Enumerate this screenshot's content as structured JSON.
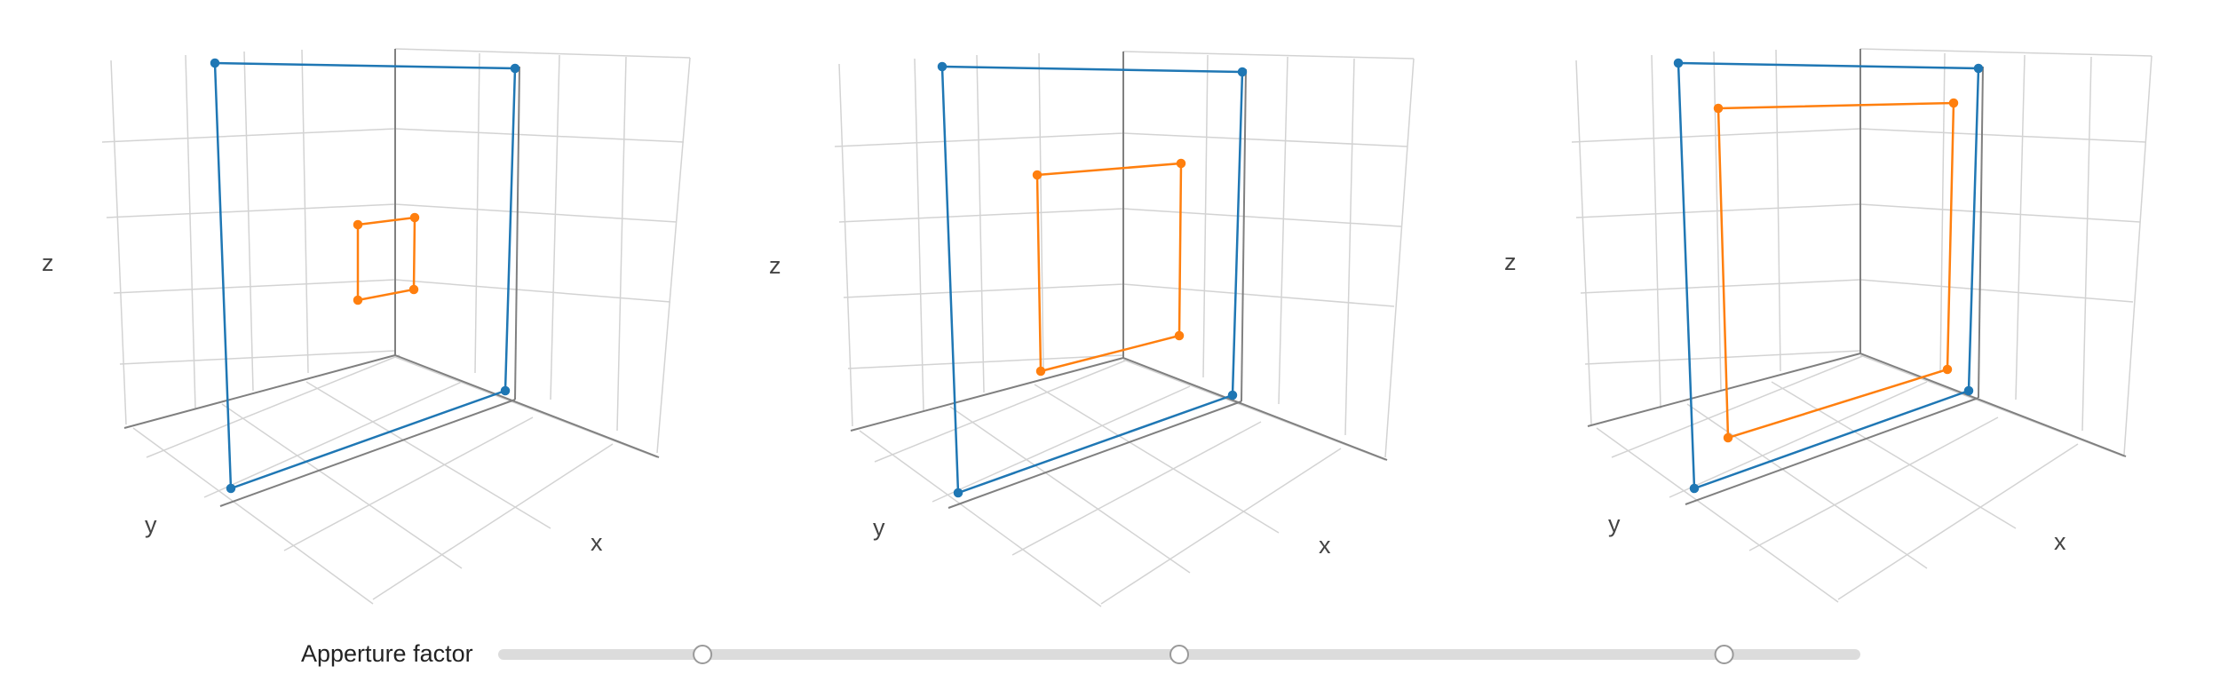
{
  "axis_labels": {
    "x": "x",
    "y": "y",
    "z": "z"
  },
  "slider": {
    "label": "Apperture factor",
    "handle_values": [
      0.15,
      0.5,
      0.9
    ]
  },
  "colors": {
    "outer_frame": "#1f77b4",
    "inner_frame": "#ff7f0e",
    "grid": "#d3d3d3",
    "axis": "#808080",
    "slider_track": "#dcdcdc",
    "slider_handle_border": "#9a9a9a"
  },
  "chart_data": {
    "type": "scatter",
    "description_of_series": "3D wireframe rectangles: outer (fixed) and inner (scaled by aperture factor)",
    "series": [
      {
        "name": "",
        "color": "#1f77b4",
        "role": "outer"
      },
      {
        "name": "",
        "color": "#ff7f0e",
        "role": "inner"
      }
    ],
    "panels": [
      {
        "aperture_factor": 0.15
      },
      {
        "aperture_factor": 0.5
      },
      {
        "aperture_factor": 0.9
      }
    ]
  }
}
